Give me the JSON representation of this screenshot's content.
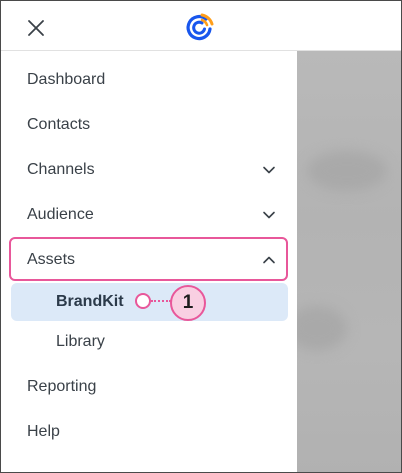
{
  "header": {
    "close_icon": "close-icon",
    "logo": "constant-contact-logo"
  },
  "menu": {
    "items": [
      {
        "label": "Dashboard",
        "has_chevron": false
      },
      {
        "label": "Contacts",
        "has_chevron": false
      },
      {
        "label": "Channels",
        "has_chevron": true,
        "chevron": "chevron-down-icon"
      },
      {
        "label": "Audience",
        "has_chevron": true,
        "chevron": "chevron-down-icon"
      },
      {
        "label": "Assets",
        "has_chevron": true,
        "chevron": "chevron-up-icon",
        "expanded": true
      },
      {
        "label": "BrandKit",
        "sub": true,
        "active": true
      },
      {
        "label": "Library",
        "sub": true
      },
      {
        "label": "Reporting",
        "has_chevron": false
      },
      {
        "label": "Help",
        "has_chevron": false
      }
    ]
  },
  "annotation": {
    "callout_number": "1",
    "accent_color": "#e8579a"
  },
  "colors": {
    "active_bg": "#dce9f8",
    "text": "#3a4148",
    "logo_blue": "#1856ed",
    "logo_orange": "#ff9e1a"
  }
}
